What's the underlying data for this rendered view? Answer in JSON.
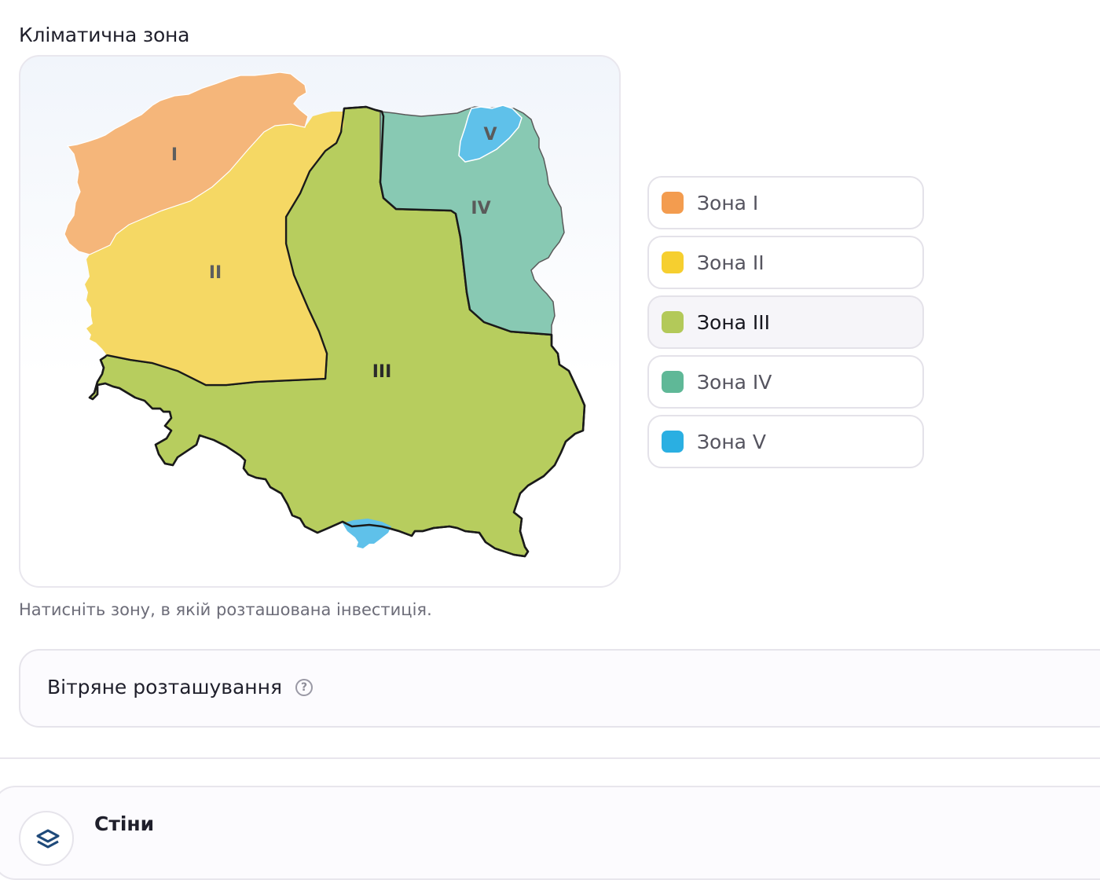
{
  "section": {
    "title": "Кліматична зона"
  },
  "map": {
    "labels": {
      "zone1": "I",
      "zone2": "II",
      "zone3": "III",
      "zone4": "IV",
      "zone5": "V"
    },
    "colors": {
      "zone1": "#f5b67a",
      "zone2": "#f5d864",
      "zone3": "#b7cd5e",
      "zone4": "#88c9b3",
      "zone5": "#5fc1ea",
      "outline": "#1a1a1a"
    }
  },
  "hint": "Натисніть зону, в якій розташована інвестиція.",
  "zones": [
    {
      "label": "Зона I",
      "color": "#f39c4f",
      "selected": false
    },
    {
      "label": "Зона II",
      "color": "#f6cf2f",
      "selected": false
    },
    {
      "label": "Зона III",
      "color": "#b3c959",
      "selected": true
    },
    {
      "label": "Зона IV",
      "color": "#5fb897",
      "selected": false
    },
    {
      "label": "Зона V",
      "color": "#2aafe2",
      "selected": false
    }
  ],
  "wind": {
    "label": "Вітряне розташування",
    "help_icon": "question-circle-icon"
  },
  "walls": {
    "title": "Стіни",
    "icon": "layers-icon"
  }
}
